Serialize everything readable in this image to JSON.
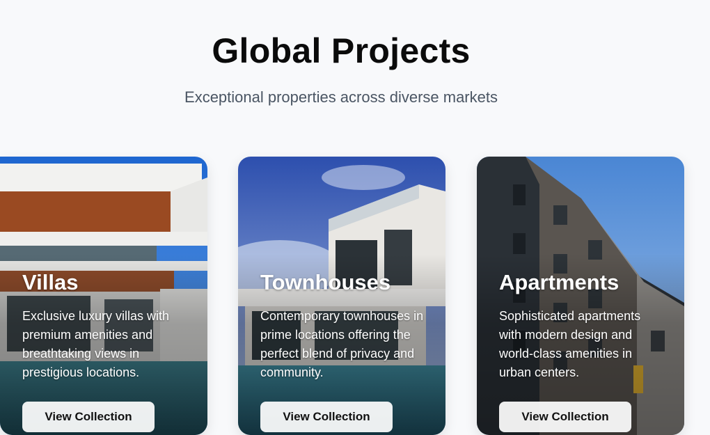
{
  "header": {
    "title": "Global Projects",
    "subtitle": "Exceptional properties across diverse markets"
  },
  "cards": [
    {
      "title": "Villas",
      "description": "Exclusive luxury villas with premium amenities and breathtaking views in prestigious locations.",
      "cta": "View Collection"
    },
    {
      "title": "Townhouses",
      "description": "Contemporary townhouses in prime locations offering the perfect blend of privacy and community.",
      "cta": "View Collection"
    },
    {
      "title": "Apartments",
      "description": "Sophisticated apartments with modern design and world-class amenities in urban centers.",
      "cta": "View Collection"
    }
  ]
}
